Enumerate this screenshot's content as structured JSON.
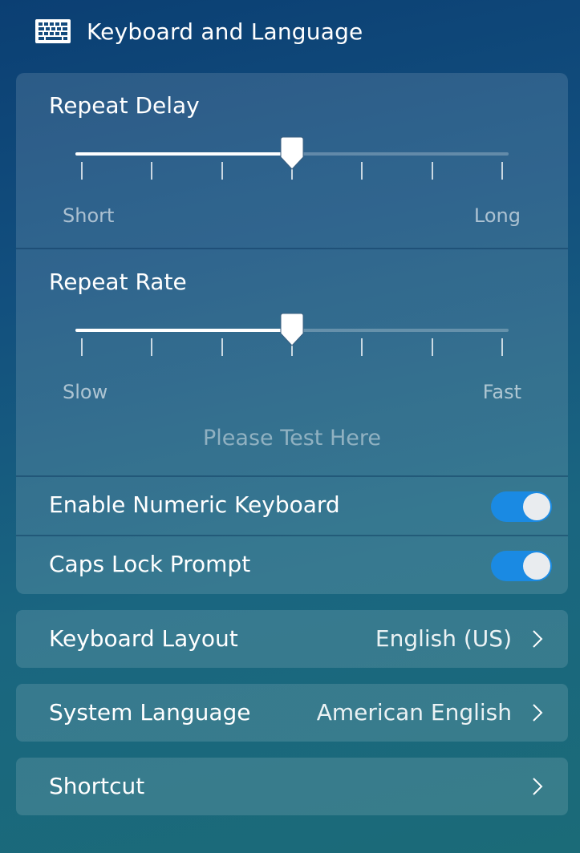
{
  "header": {
    "title": "Keyboard and Language",
    "icon": "keyboard-icon"
  },
  "repeat_delay": {
    "title": "Repeat Delay",
    "min_label": "Short",
    "max_label": "Long",
    "value_fraction": 0.5,
    "tick_count": 7
  },
  "repeat_rate": {
    "title": "Repeat Rate",
    "min_label": "Slow",
    "max_label": "Fast",
    "value_fraction": 0.5,
    "tick_count": 7
  },
  "test_field": {
    "placeholder": "Please Test Here"
  },
  "toggles": {
    "numeric_keyboard": {
      "label": "Enable Numeric Keyboard",
      "on": true
    },
    "caps_lock_prompt": {
      "label": "Caps Lock Prompt",
      "on": true
    }
  },
  "nav": {
    "keyboard_layout": {
      "label": "Keyboard Layout",
      "value": "English (US)",
      "icon": "chevron-right-icon"
    },
    "system_language": {
      "label": "System Language",
      "value": "American English",
      "icon": "chevron-right-icon"
    },
    "shortcut": {
      "label": "Shortcut",
      "icon": "chevron-right-icon"
    }
  },
  "colors": {
    "toggle_on": "#1a8ae3",
    "background_top": "#0b3f73",
    "background_bottom": "#1b6b78"
  }
}
